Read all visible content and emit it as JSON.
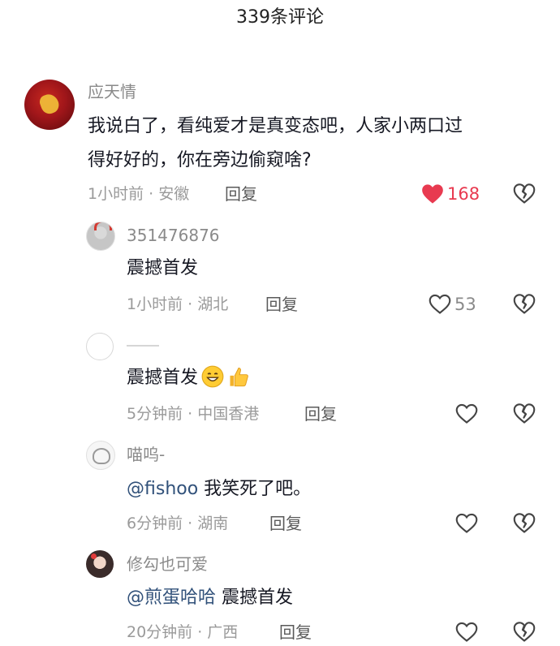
{
  "header": {
    "title": "339条评论"
  },
  "comments": [
    {
      "username": "应天情",
      "text": "我说白了，看纯爱才是真变态吧，人家小两口过",
      "text2": "得好好的，你在旁边偷窥啥?",
      "meta": "1小时前 · 安徽",
      "reply": "回复",
      "likes": "168",
      "liked": true
    },
    {
      "username": "351476876",
      "text": "震撼首发",
      "meta": "1小时前 · 湖北",
      "reply": "回复",
      "likes": "53"
    },
    {
      "username": "",
      "text": "震撼首发",
      "meta": "5分钟前 · 中国香港",
      "reply": "回复"
    },
    {
      "username": "喵呜-",
      "mention": "@fishoo",
      "text": " 我笑死了吧。",
      "meta": "6分钟前 · 湖南",
      "reply": "回复"
    },
    {
      "username": "修勾也可爱",
      "mention": "@煎蛋哈哈",
      "text": " 震撼首发",
      "meta": "20分钟前 · 广西",
      "reply": "回复"
    }
  ],
  "icons": {
    "like": "heart-icon",
    "dislike": "broken-heart-icon",
    "emoji_grin": "grinning-face-icon",
    "emoji_thumb": "thumbs-up-icon"
  },
  "colors": {
    "like_active": "#e83a50",
    "mention": "#31517a",
    "meta": "#9a9a9a"
  }
}
